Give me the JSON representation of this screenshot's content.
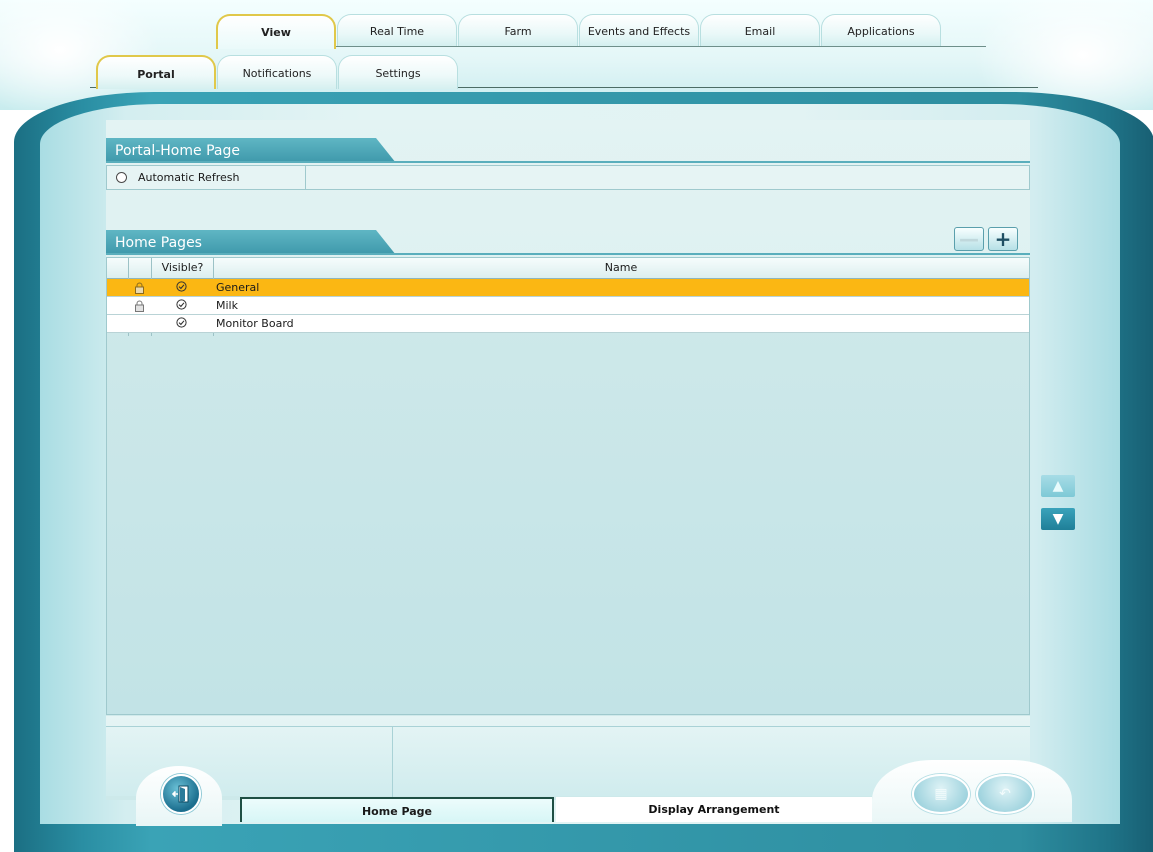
{
  "top_tabs": [
    {
      "label": "View",
      "active": true
    },
    {
      "label": "Real Time",
      "active": false
    },
    {
      "label": "Farm",
      "active": false
    },
    {
      "label": "Events and Effects",
      "active": false
    },
    {
      "label": "Email",
      "active": false
    },
    {
      "label": "Applications",
      "active": false
    }
  ],
  "sub_tabs": [
    {
      "label": "Portal",
      "active": true
    },
    {
      "label": "Notifications",
      "active": false
    },
    {
      "label": "Settings",
      "active": false
    }
  ],
  "portal_section": {
    "title": "Portal-Home Page",
    "refresh_label": "Automatic Refresh",
    "refresh_checked": false
  },
  "home_pages": {
    "title": "Home Pages",
    "add_icon": "plus-icon",
    "remove_icon": "minus-icon",
    "columns": {
      "visible": "Visible?",
      "name": "Name"
    },
    "rows": [
      {
        "name": "General",
        "locked": true,
        "visible": true,
        "selected": true
      },
      {
        "name": "Milk",
        "locked": true,
        "visible": true,
        "selected": false
      },
      {
        "name": "Monitor Board",
        "locked": false,
        "visible": true,
        "selected": false
      }
    ]
  },
  "bottom_tabs": {
    "home_page": "Home Page",
    "display_arrangement": "Display Arrangement"
  },
  "colors": {
    "accent": "#3e98aa",
    "selected_row": "#fbb713",
    "active_tab_border": "#e0c84a"
  },
  "icons": {
    "exit": "exit-door-icon",
    "save": "save-disk-icon",
    "undo": "undo-arrow-icon",
    "move_up": "arrow-up-icon",
    "move_down": "arrow-down-icon"
  }
}
